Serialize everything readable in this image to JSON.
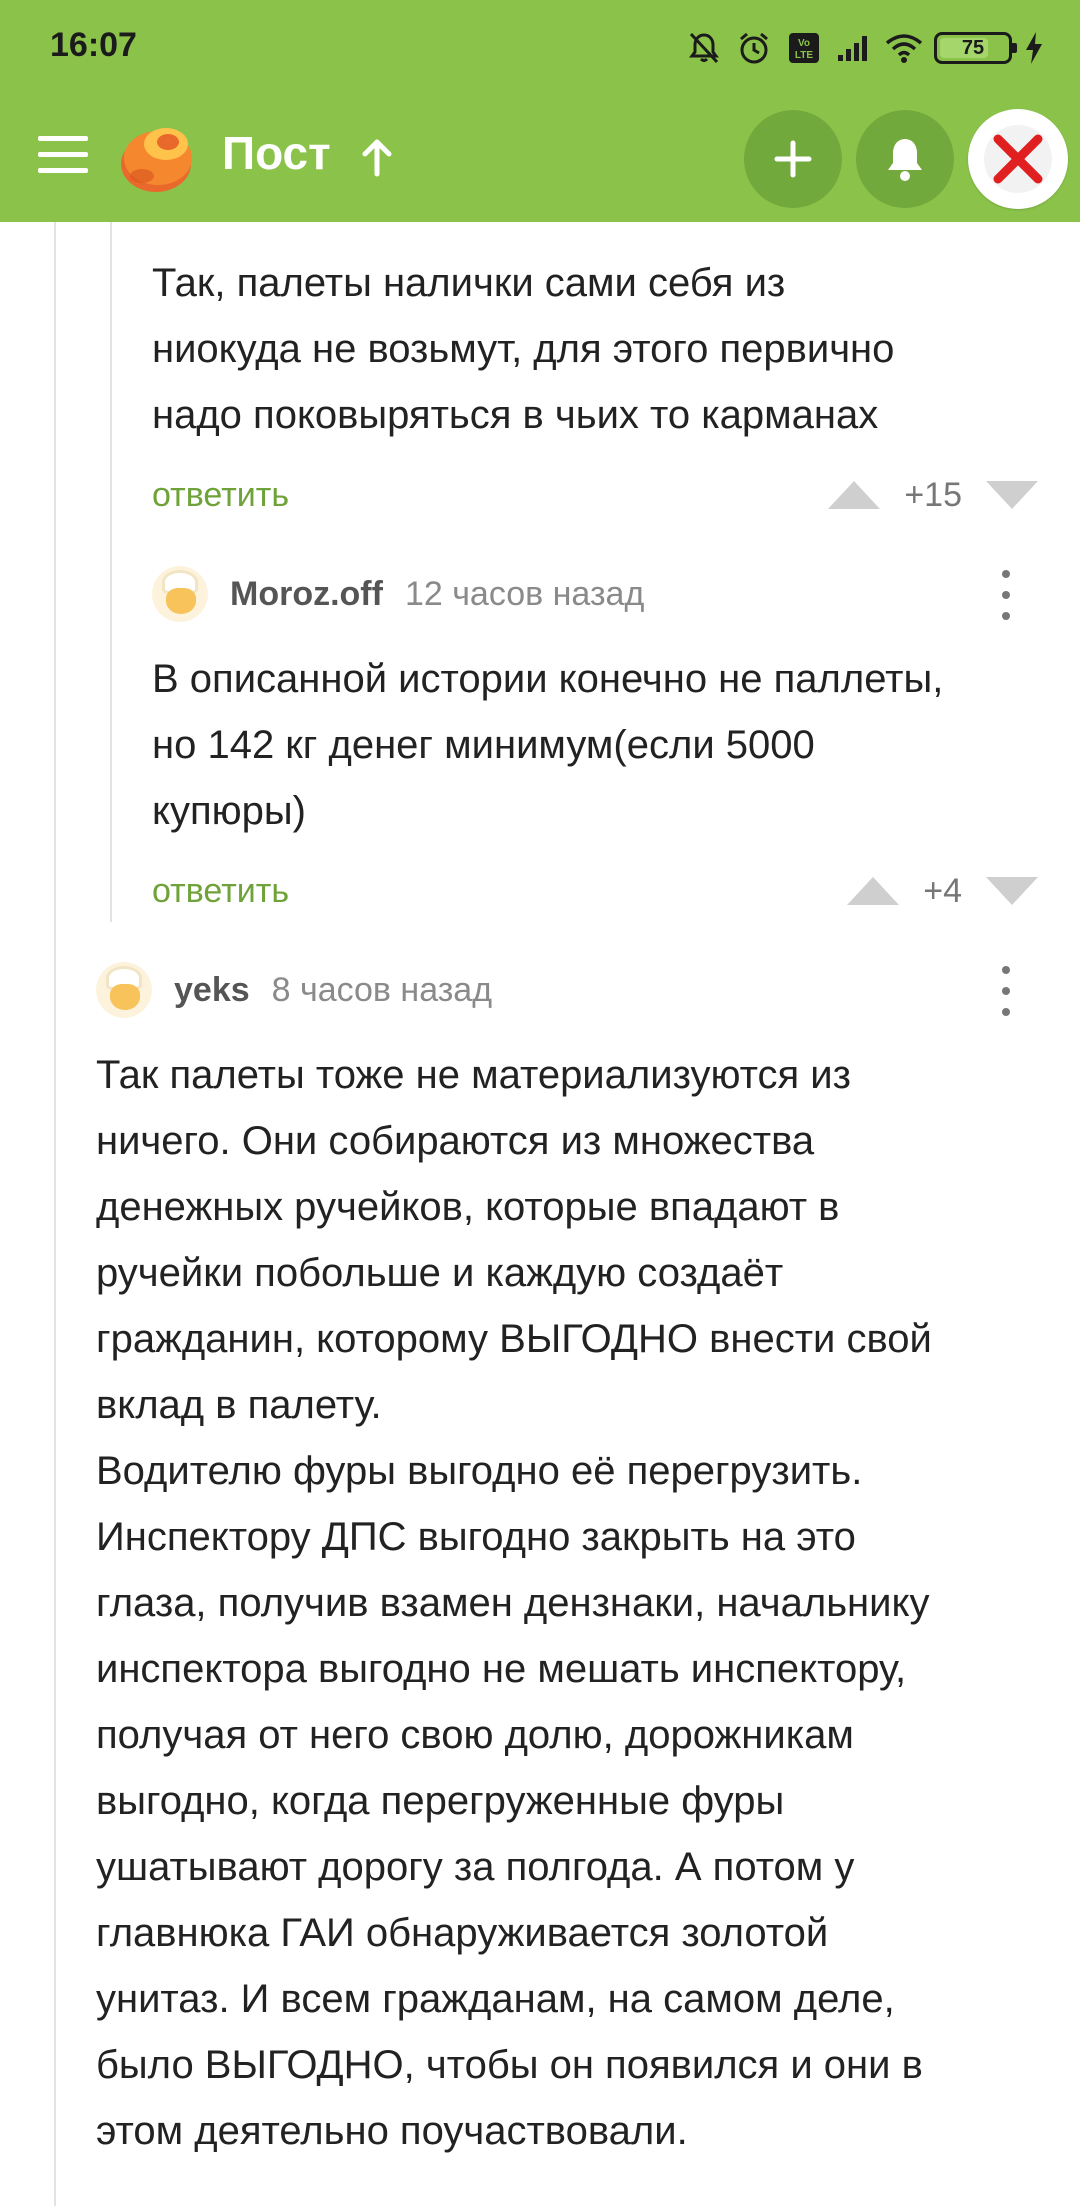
{
  "status_bar": {
    "time": "16:07",
    "battery": "75",
    "icons": [
      "mute-icon",
      "alarm-icon",
      "volte-icon",
      "signal-icon",
      "wifi-icon",
      "battery-icon",
      "charging-icon"
    ]
  },
  "toolbar": {
    "title": "Пост",
    "icons": [
      "menu-icon",
      "pikabu-logo",
      "arrow-up-icon",
      "plus-icon",
      "bell-icon",
      "close-icon"
    ],
    "accent_color": "#8bc34a"
  },
  "comments": [
    {
      "text": "Так, палеты налички сами себя из\nниокуда не возьмут, для этого первично\nнадо поковыряться в чьих то карманах",
      "reply": "ответить",
      "score": "+15"
    },
    {
      "author": "Moroz.off",
      "time": "12 часов назад",
      "text": "В описанной истории конечно не паллеты,\nно 142 кг денег минимум(если 5000\nкупюры)",
      "reply": "ответить",
      "score": "+4"
    },
    {
      "author": "yeks",
      "time": "8 часов назад",
      "text": "Так палеты тоже не материализуются из\nничего. Они собираются из множества\nденежных ручейков, которые впадают в\nручейки побольше и каждую создаёт\nгражданин, которому ВЫГОДНО внести свой\nвклад в палету.\nВодителю фуры выгодно её перегрузить.\nИнспектору ДПС выгодно закрыть на это\nглаза, получив взамен дензнаки, начальнику\nинспектора выгодно не мешать инспектору,\nполучая от него свою долю, дорожникам\nвыгодно, когда перегруженные фуры\nушатывают дорогу за полгода. А потом у\nглавнюка ГАИ обнаруживается золотой\nунитаз. И всем гражданам, на самом деле,\nбыло ВЫГОДНО, чтобы он появился и они в\nэтом деятельно поучаствовали."
    }
  ]
}
